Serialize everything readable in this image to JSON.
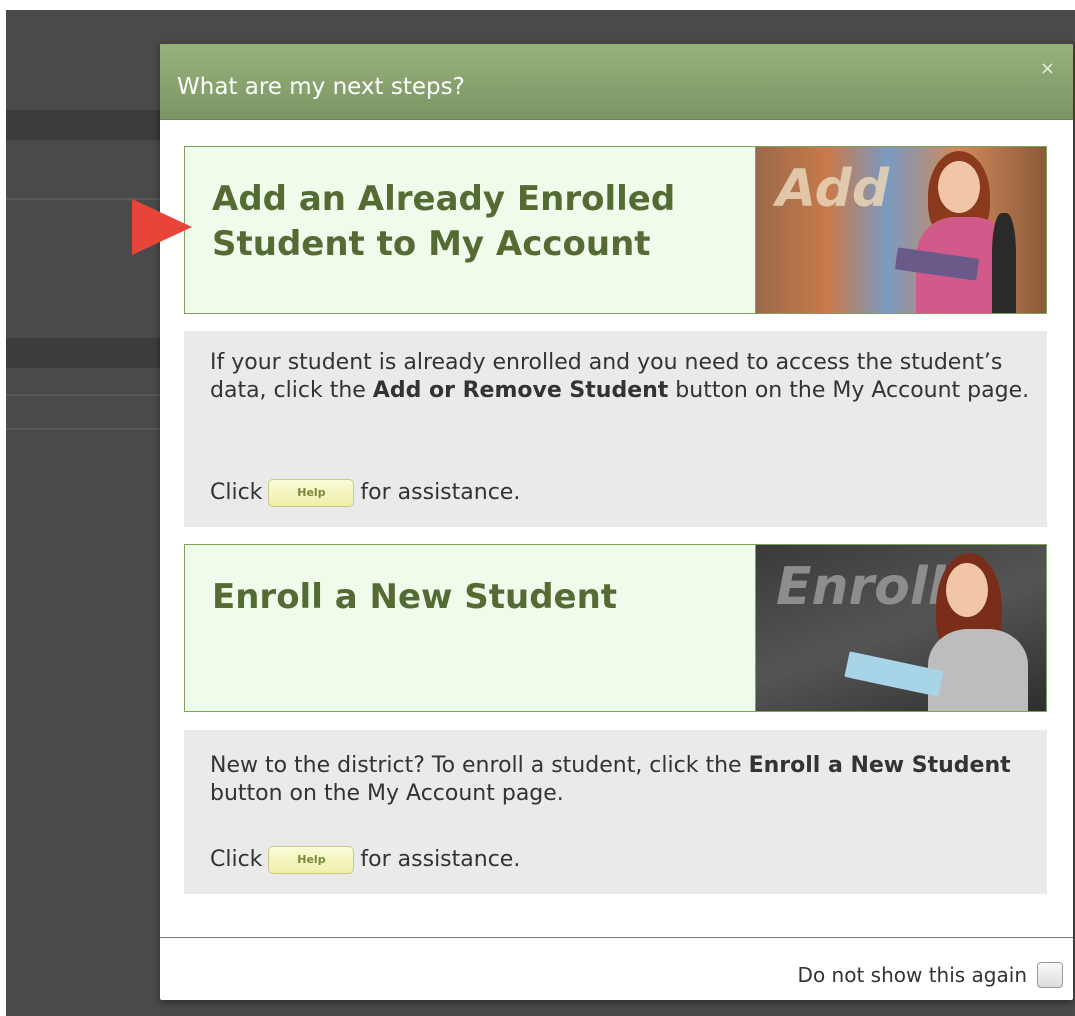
{
  "modal": {
    "title": "What are my next steps?",
    "close_label": "×"
  },
  "cards": [
    {
      "title_line1": "Add an Already Enrolled",
      "title_line2": "Student to My Account",
      "image_word": "Add"
    },
    {
      "title_line1": "Enroll a New Student",
      "image_word": "Enroll"
    }
  ],
  "info": [
    {
      "text_pre": "If your student is already enrolled and you need to access the student’s data, click the ",
      "text_bold": "Add or Remove Student",
      "text_post": " button on the My Account page.",
      "click_label": "Click",
      "help_label": "Help",
      "assist_label": "for assistance."
    },
    {
      "text_pre": "New to the district? To enroll a student, click the ",
      "text_bold": "Enroll a New Student",
      "text_post": " button on the My Account page.",
      "click_label": "Click",
      "help_label": "Help",
      "assist_label": "for assistance."
    }
  ],
  "footer": {
    "dont_show_label": "Do not show this again"
  },
  "colors": {
    "accent_header": "#8aa36f",
    "card_bg": "#effcec",
    "card_title": "#566b33",
    "pointer_arrow": "#e8443a"
  }
}
